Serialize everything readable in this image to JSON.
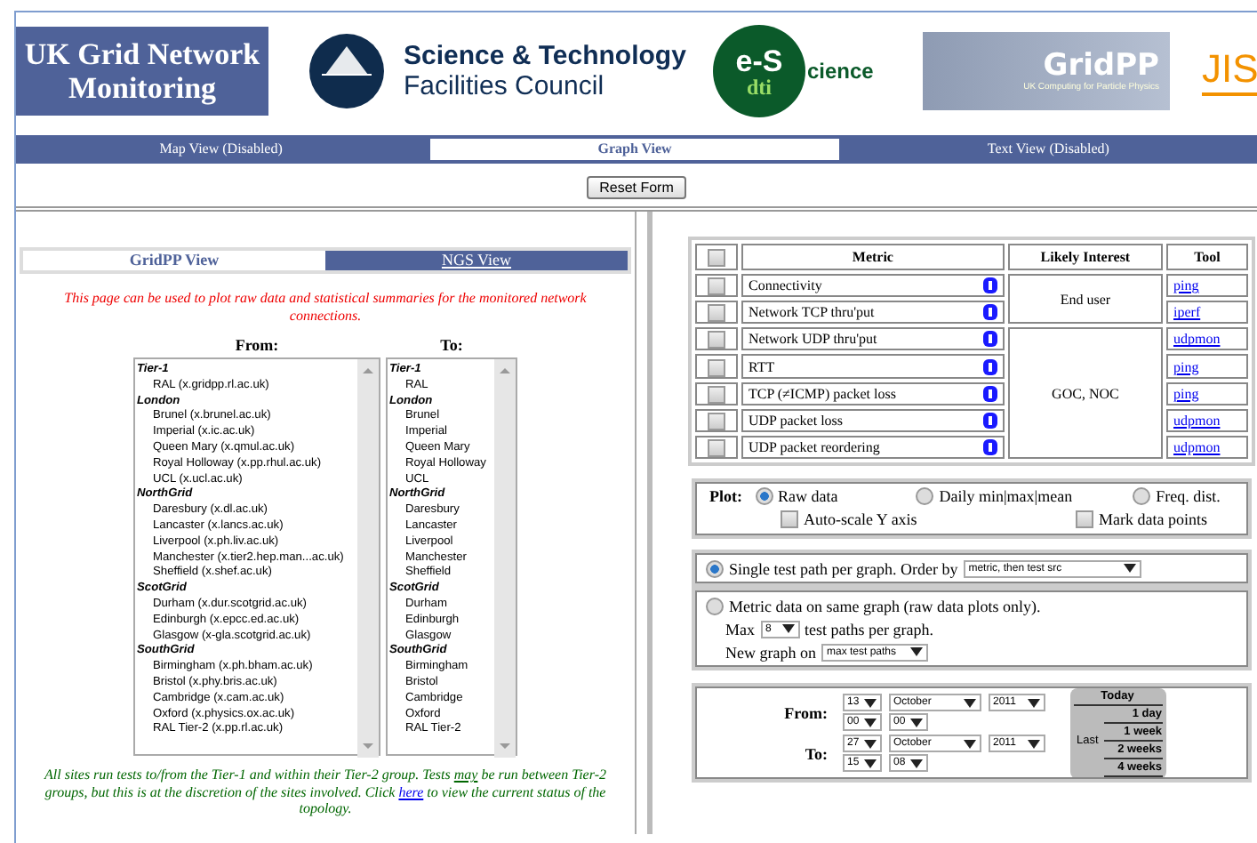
{
  "header": {
    "title": "UK Grid Network Monitoring",
    "logos": [
      {
        "kind": "stfc",
        "lines": [
          "Science & Technology",
          "Facilities Council"
        ]
      },
      {
        "kind": "escience",
        "lines": [
          "e-S",
          "cience",
          "dti"
        ]
      },
      {
        "kind": "gridpp",
        "lines": [
          "GridPP",
          "UK Computing for Particle Physics"
        ]
      },
      {
        "kind": "jisc",
        "lines": [
          "JIS"
        ]
      }
    ]
  },
  "view_tabs": [
    {
      "label": "Map View (Disabled)",
      "selected": false
    },
    {
      "label": "Graph View",
      "selected": true
    },
    {
      "label": "Text View (Disabled)",
      "selected": false
    }
  ],
  "reset_button": "Reset Form",
  "site_tabs": [
    {
      "label": "GridPP View",
      "selected": true
    },
    {
      "label": "NGS View",
      "selected": false
    }
  ],
  "intro": "This page can be used to plot raw data and statistical summaries for the monitored network connections.",
  "site_lists": [
    {
      "label": "From:",
      "groups": [
        {
          "name": "Tier-1",
          "sites": [
            "RAL (x.gridpp.rl.ac.uk)"
          ]
        },
        {
          "name": "London",
          "sites": [
            "Brunel (x.brunel.ac.uk)",
            "Imperial (x.ic.ac.uk)",
            "Queen Mary (x.qmul.ac.uk)",
            "Royal Holloway (x.pp.rhul.ac.uk)",
            "UCL (x.ucl.ac.uk)"
          ]
        },
        {
          "name": "NorthGrid",
          "sites": [
            "Daresbury (x.dl.ac.uk)",
            "Lancaster (x.lancs.ac.uk)",
            "Liverpool (x.ph.liv.ac.uk)",
            "Manchester (x.tier2.hep.man...ac.uk)",
            "Sheffield (x.shef.ac.uk)"
          ]
        },
        {
          "name": "ScotGrid",
          "sites": [
            "Durham (x.dur.scotgrid.ac.uk)",
            "Edinburgh (x.epcc.ed.ac.uk)",
            "Glasgow (x-gla.scotgrid.ac.uk)"
          ]
        },
        {
          "name": "SouthGrid",
          "sites": [
            "Birmingham (x.ph.bham.ac.uk)",
            "Bristol (x.phy.bris.ac.uk)",
            "Cambridge (x.cam.ac.uk)",
            "Oxford (x.physics.ox.ac.uk)",
            "RAL Tier-2 (x.pp.rl.ac.uk)"
          ]
        }
      ]
    },
    {
      "label": "To:",
      "groups": [
        {
          "name": "Tier-1",
          "sites": [
            "RAL"
          ]
        },
        {
          "name": "London",
          "sites": [
            "Brunel",
            "Imperial",
            "Queen Mary",
            "Royal Holloway",
            "UCL"
          ]
        },
        {
          "name": "NorthGrid",
          "sites": [
            "Daresbury",
            "Lancaster",
            "Liverpool",
            "Manchester",
            "Sheffield"
          ]
        },
        {
          "name": "ScotGrid",
          "sites": [
            "Durham",
            "Edinburgh",
            "Glasgow"
          ]
        },
        {
          "name": "SouthGrid",
          "sites": [
            "Birmingham",
            "Bristol",
            "Cambridge",
            "Oxford",
            "RAL Tier-2"
          ]
        }
      ]
    }
  ],
  "note": {
    "before": "All sites run tests to/from the Tier-1 and within their Tier-2 group. Tests ",
    "underlined": "may",
    "middle": " be run between Tier-2 groups, but this is at the discretion of the sites involved. Click ",
    "link": "here",
    "after": " to view the current status of the topology."
  },
  "metrics": {
    "all_checked": false,
    "columns": [
      "Metric",
      "Likely Interest",
      "Tool"
    ],
    "interest_groups": [
      {
        "label": "End user",
        "rows": [
          {
            "name": "Connectivity",
            "checked": false,
            "tool": "ping"
          },
          {
            "name": "Network TCP thru'put",
            "checked": false,
            "tool": "iperf"
          }
        ]
      },
      {
        "label": "GOC, NOC",
        "rows": [
          {
            "name": "Network UDP thru'put",
            "checked": false,
            "tool": "udpmon"
          },
          {
            "name": "RTT",
            "checked": false,
            "tool": "ping"
          },
          {
            "name": "TCP (≠ICMP) packet loss",
            "checked": false,
            "tool": "ping"
          },
          {
            "name": "UDP packet loss",
            "checked": false,
            "tool": "udpmon"
          },
          {
            "name": "UDP packet reordering",
            "checked": false,
            "tool": "udpmon"
          }
        ]
      }
    ]
  },
  "plot": {
    "label": "Plot:",
    "options": [
      {
        "label": "Raw data",
        "selected": true
      },
      {
        "label": "Daily min|max|mean",
        "selected": false
      },
      {
        "label": "Freq. dist.",
        "selected": false
      }
    ],
    "checks": [
      {
        "label": "Auto-scale Y axis",
        "checked": false
      },
      {
        "label": "Mark data points",
        "checked": false
      }
    ]
  },
  "grouping": [
    {
      "kind": "single",
      "selected": true,
      "text": "Single test path per graph. Order by",
      "order": "metric, then test src"
    },
    {
      "kind": "combined",
      "selected": false,
      "text": "Metric data on same graph (raw data plots only).",
      "max_label": "Max",
      "max_value": "8",
      "max_suffix": "test paths per graph.",
      "new_label": "New graph on",
      "new_value": "max test paths"
    }
  ],
  "dates": [
    {
      "label": "From:",
      "day": "13",
      "month": "October",
      "year": "2011",
      "hour": "00",
      "minute": "00"
    },
    {
      "label": "To:",
      "day": "27",
      "month": "October",
      "year": "2011",
      "hour": "15",
      "minute": "08"
    }
  ],
  "quick": {
    "today": "Today",
    "last": "Last",
    "ranges": [
      "1 day",
      "1 week",
      "2 weeks",
      "4 weeks"
    ]
  }
}
